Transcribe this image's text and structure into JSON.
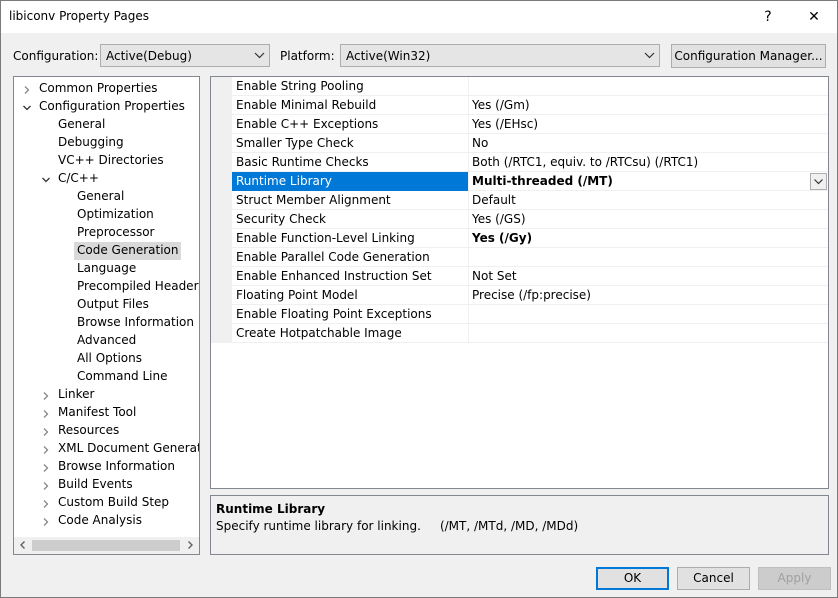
{
  "window": {
    "title": "libiconv Property Pages",
    "help_label": "?",
    "close_label": "✕"
  },
  "toolbar": {
    "configuration_label": "Configuration:",
    "configuration_value": "Active(Debug)",
    "platform_label": "Platform:",
    "platform_value": "Active(Win32)",
    "configuration_manager_label": "Configuration Manager..."
  },
  "tree": {
    "items": [
      {
        "label": "Common Properties",
        "state": "collapsed"
      },
      {
        "label": "Configuration Properties",
        "state": "expanded"
      },
      {
        "label": "General",
        "state": "leaf"
      },
      {
        "label": "Debugging",
        "state": "leaf"
      },
      {
        "label": "VC++ Directories",
        "state": "leaf"
      },
      {
        "label": "C/C++",
        "state": "expanded"
      },
      {
        "label": "General",
        "state": "leaf"
      },
      {
        "label": "Optimization",
        "state": "leaf"
      },
      {
        "label": "Preprocessor",
        "state": "leaf"
      },
      {
        "label": "Code Generation",
        "state": "leaf",
        "selected": true
      },
      {
        "label": "Language",
        "state": "leaf"
      },
      {
        "label": "Precompiled Headers",
        "state": "leaf"
      },
      {
        "label": "Output Files",
        "state": "leaf"
      },
      {
        "label": "Browse Information",
        "state": "leaf"
      },
      {
        "label": "Advanced",
        "state": "leaf"
      },
      {
        "label": "All Options",
        "state": "leaf"
      },
      {
        "label": "Command Line",
        "state": "leaf"
      },
      {
        "label": "Linker",
        "state": "collapsed"
      },
      {
        "label": "Manifest Tool",
        "state": "collapsed"
      },
      {
        "label": "Resources",
        "state": "collapsed"
      },
      {
        "label": "XML Document Generator",
        "state": "collapsed"
      },
      {
        "label": "Browse Information",
        "state": "collapsed"
      },
      {
        "label": "Build Events",
        "state": "collapsed"
      },
      {
        "label": "Custom Build Step",
        "state": "collapsed"
      },
      {
        "label": "Code Analysis",
        "state": "collapsed"
      }
    ]
  },
  "properties": [
    {
      "name": "Enable String Pooling",
      "value": ""
    },
    {
      "name": "Enable Minimal Rebuild",
      "value": "Yes (/Gm)"
    },
    {
      "name": "Enable C++ Exceptions",
      "value": "Yes (/EHsc)"
    },
    {
      "name": "Smaller Type Check",
      "value": "No"
    },
    {
      "name": "Basic Runtime Checks",
      "value": "Both (/RTC1, equiv. to /RTCsu) (/RTC1)"
    },
    {
      "name": "Runtime Library",
      "value": "Multi-threaded (/MT)",
      "selected": true,
      "bold": true
    },
    {
      "name": "Struct Member Alignment",
      "value": "Default"
    },
    {
      "name": "Security Check",
      "value": "Yes (/GS)"
    },
    {
      "name": "Enable Function-Level Linking",
      "value": "Yes (/Gy)",
      "bold": true
    },
    {
      "name": "Enable Parallel Code Generation",
      "value": ""
    },
    {
      "name": "Enable Enhanced Instruction Set",
      "value": "Not Set"
    },
    {
      "name": "Floating Point Model",
      "value": "Precise (/fp:precise)"
    },
    {
      "name": "Enable Floating Point Exceptions",
      "value": ""
    },
    {
      "name": "Create Hotpatchable Image",
      "value": ""
    }
  ],
  "description": {
    "title": "Runtime Library",
    "text": "Specify runtime library for linking.     (/MT, /MTd, /MD, /MDd)"
  },
  "buttons": {
    "ok": "OK",
    "cancel": "Cancel",
    "apply": "Apply"
  },
  "colors": {
    "selection": "#0078d7",
    "tree_selection": "#d9d9d9"
  }
}
